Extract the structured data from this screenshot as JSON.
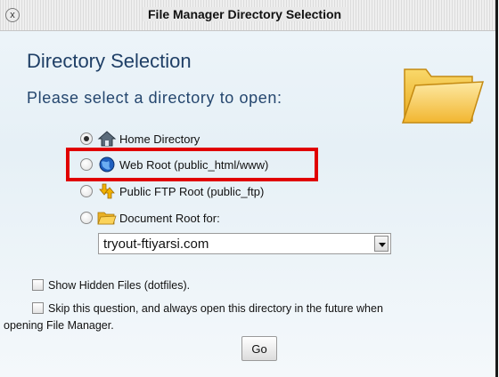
{
  "window": {
    "title": "File Manager Directory Selection",
    "close_glyph": "x"
  },
  "main": {
    "heading": "Directory Selection",
    "prompt": "Please select a directory to open:"
  },
  "options": [
    {
      "label": "Home Directory",
      "icon": "home-icon",
      "selected": true
    },
    {
      "label": "Web Root (public_html/www)",
      "icon": "globe-icon",
      "selected": false,
      "highlighted": true
    },
    {
      "label": "Public FTP Root (public_ftp)",
      "icon": "ftp-icon",
      "selected": false
    },
    {
      "label": "Document Root for:",
      "icon": "folder-icon",
      "selected": false
    }
  ],
  "domain_select": {
    "value": "tryout-ftiyarsi.com"
  },
  "checkboxes": {
    "show_hidden": "Show Hidden Files (dotfiles).",
    "skip_question_line1": "Skip this question, and always open this directory in the future when",
    "skip_question_line2": "opening File Manager."
  },
  "buttons": {
    "go": "Go"
  },
  "colors": {
    "heading": "#1f3f66",
    "highlight_border": "#e00000",
    "folder_yellow": "#f6c334"
  }
}
